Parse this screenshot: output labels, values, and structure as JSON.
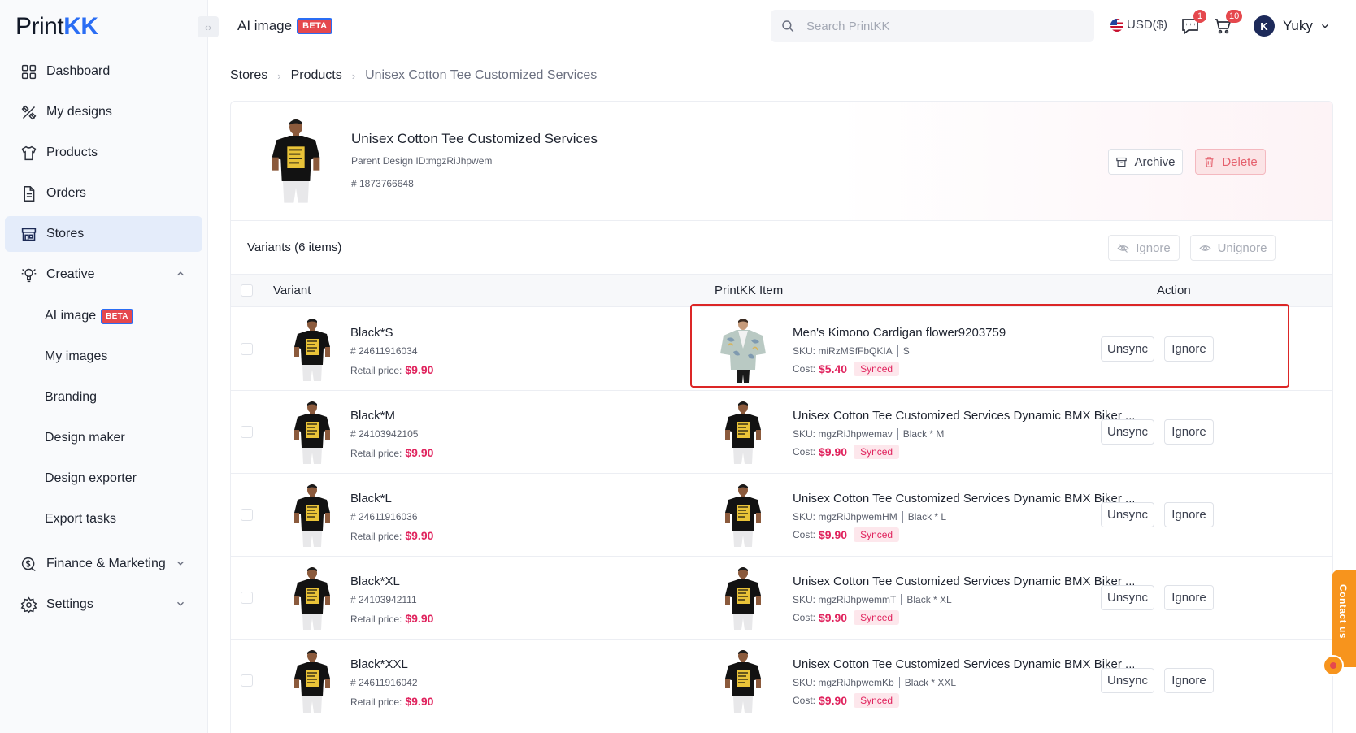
{
  "brand": {
    "logo_main": "Print",
    "logo_accent": "KK"
  },
  "header": {
    "title": "AI image",
    "beta": "BETA",
    "search_placeholder": "Search PrintKK",
    "currency": "USD($)",
    "messages_count": "1",
    "cart_count": "10",
    "user_initial": "K",
    "user_name": "Yuky"
  },
  "sidebar": {
    "items": [
      {
        "label": "Dashboard"
      },
      {
        "label": "My designs"
      },
      {
        "label": "Products"
      },
      {
        "label": "Orders"
      },
      {
        "label": "Stores"
      },
      {
        "label": "Creative"
      },
      {
        "label": "Finance & Marketing"
      },
      {
        "label": "Settings"
      }
    ],
    "creative_sub": [
      {
        "label": "AI image"
      },
      {
        "label": "My images"
      },
      {
        "label": "Branding"
      },
      {
        "label": "Design maker"
      },
      {
        "label": "Design exporter"
      },
      {
        "label": "Export tasks"
      }
    ],
    "beta": "BETA"
  },
  "breadcrumb": [
    "Stores",
    "Products",
    "Unisex Cotton Tee Customized Services"
  ],
  "product": {
    "title": "Unisex Cotton Tee Customized Services",
    "parent_design": "Parent Design ID:mgzRiJhpwem",
    "id": "# 1873766648",
    "archive_label": "Archive",
    "delete_label": "Delete"
  },
  "variants": {
    "title": "Variants (6 items)",
    "ignore_label": "Ignore",
    "unignore_label": "Unignore",
    "columns": [
      "Variant",
      "PrintKK Item",
      "Action"
    ],
    "retail_label": "Retail price:",
    "sku_label": "SKU:",
    "cost_label": "Cost:",
    "synced_label": "Synced",
    "unsync_label": "Unsync",
    "row_ignore_label": "Ignore",
    "rows": [
      {
        "name": "Black*S",
        "id": "# 24611916034",
        "price": "$9.90",
        "item": "Men's Kimono Cardigan flower9203759",
        "sku": "miRzMSfFbQKIA",
        "option": "S",
        "cost": "$5.40",
        "kimono": true
      },
      {
        "name": "Black*M",
        "id": "# 24103942105",
        "price": "$9.90",
        "item": "Unisex Cotton Tee Customized Services Dynamic BMX Biker ...",
        "sku": "mgzRiJhpwemav",
        "option": "Black * M",
        "cost": "$9.90",
        "kimono": false
      },
      {
        "name": "Black*L",
        "id": "# 24611916036",
        "price": "$9.90",
        "item": "Unisex Cotton Tee Customized Services Dynamic BMX Biker ...",
        "sku": "mgzRiJhpwemHM",
        "option": "Black * L",
        "cost": "$9.90",
        "kimono": false
      },
      {
        "name": "Black*XL",
        "id": "# 24103942111",
        "price": "$9.90",
        "item": "Unisex Cotton Tee Customized Services Dynamic BMX Biker ...",
        "sku": "mgzRiJhpwemmT",
        "option": "Black * XL",
        "cost": "$9.90",
        "kimono": false
      },
      {
        "name": "Black*XXL",
        "id": "# 24611916042",
        "price": "$9.90",
        "item": "Unisex Cotton Tee Customized Services Dynamic BMX Biker ...",
        "sku": "mgzRiJhpwemKb",
        "option": "Black * XXL",
        "cost": "$9.90",
        "kimono": false
      }
    ]
  },
  "contact": {
    "label": "Contact us"
  },
  "colors": {
    "accent": "#2a6df4",
    "price": "#e0245e",
    "highlight": "#dc2626",
    "contact": "#f7941d"
  }
}
